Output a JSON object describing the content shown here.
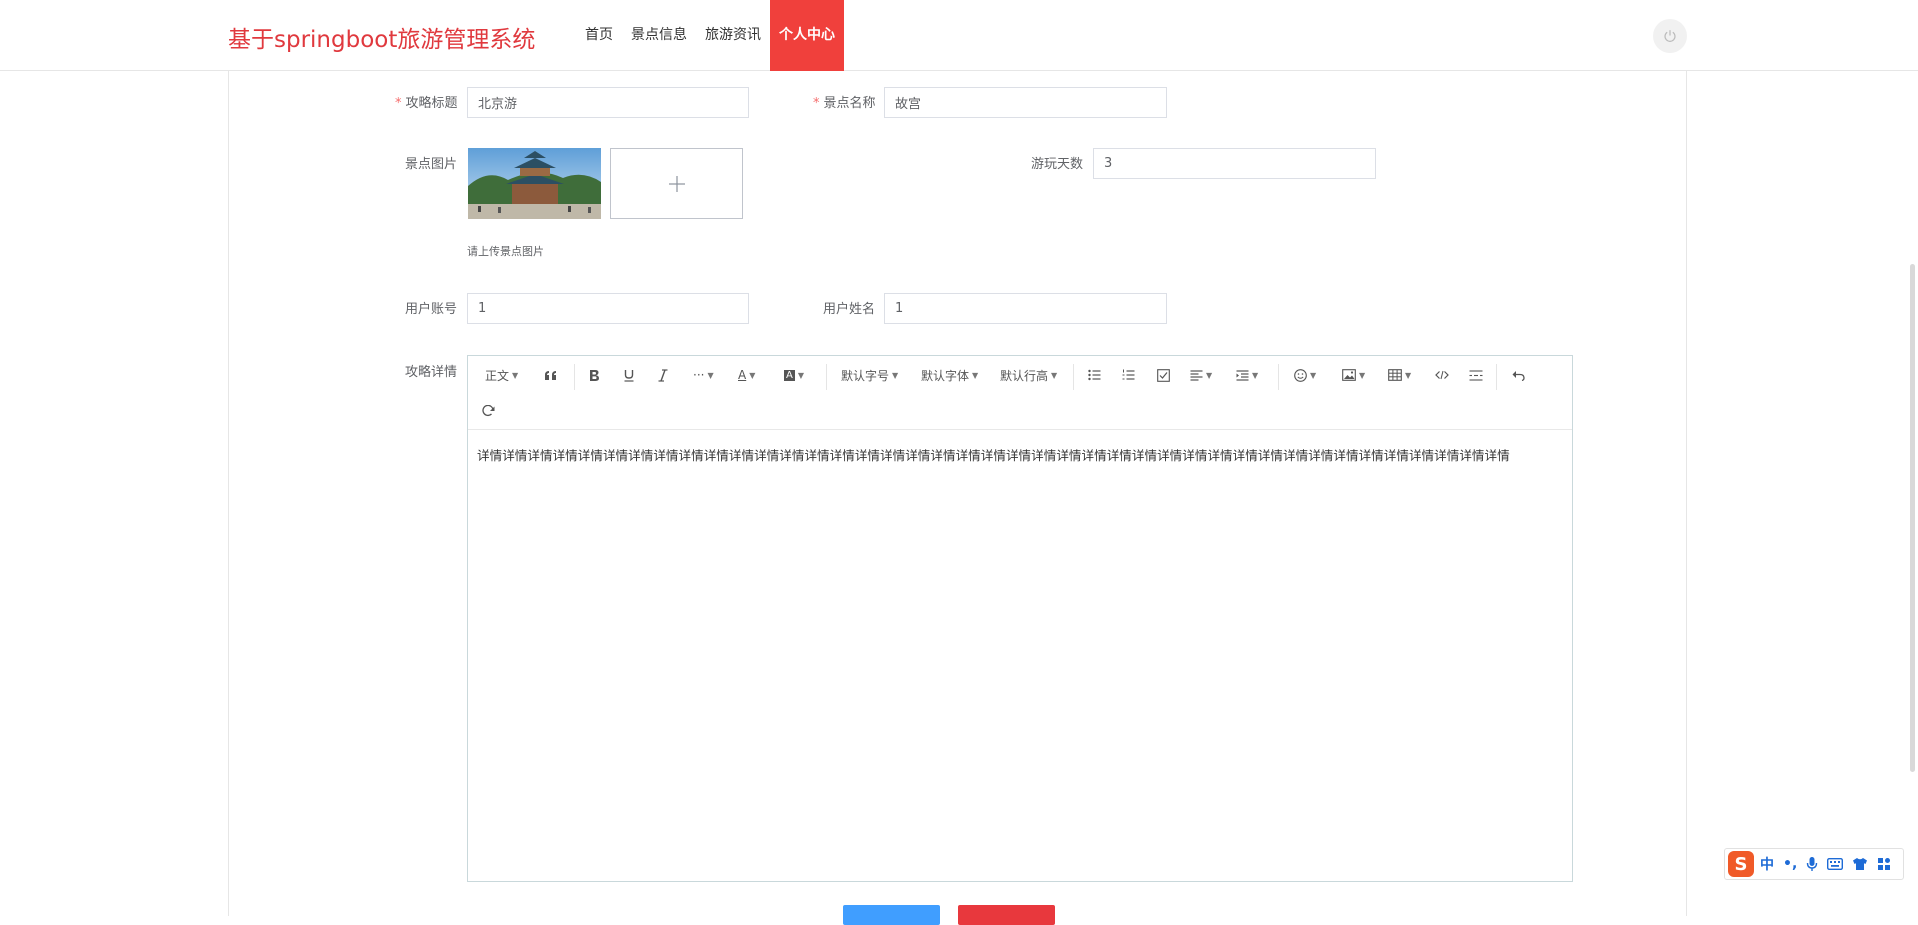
{
  "header": {
    "brand": "基于springboot旅游管理系统",
    "nav": [
      "首页",
      "景点信息",
      "旅游资讯",
      "个人中心"
    ],
    "active_nav": "个人中心",
    "power_icon": "power-icon"
  },
  "form": {
    "title_label": "攻略标题",
    "title_value": "北京游",
    "spot_label": "景点名称",
    "spot_value": "故宫",
    "image_label": "景点图片",
    "upload_hint": "请上传景点图片",
    "days_label": "游玩天数",
    "days_value": "3",
    "account_label": "用户账号",
    "account_value": "1",
    "username_label": "用户姓名",
    "username_value": "1",
    "detail_label": "攻略详情",
    "required_mark": "*"
  },
  "editor": {
    "toolbar": {
      "paragraph": "正文",
      "more": "···",
      "font_color": "A",
      "bg_color": "A",
      "font_size": "默认字号",
      "font_family": "默认字体",
      "line_height": "默认行高"
    },
    "content": "详情详情详情详情详情详情详情详情详情详情详情详情详情详情详情详情详情详情详情详情详情详情详情详情详情详情详情详情详情详情详情详情详情详情详情详情详情详情详情详情详情"
  },
  "ime": {
    "mode": "中",
    "punct": "•,"
  },
  "colors": {
    "brand": "#e0393e",
    "active_nav": "#f0403c",
    "primary_button": "#409eff",
    "danger_button": "#e8383d",
    "required": "#f56c6c"
  }
}
